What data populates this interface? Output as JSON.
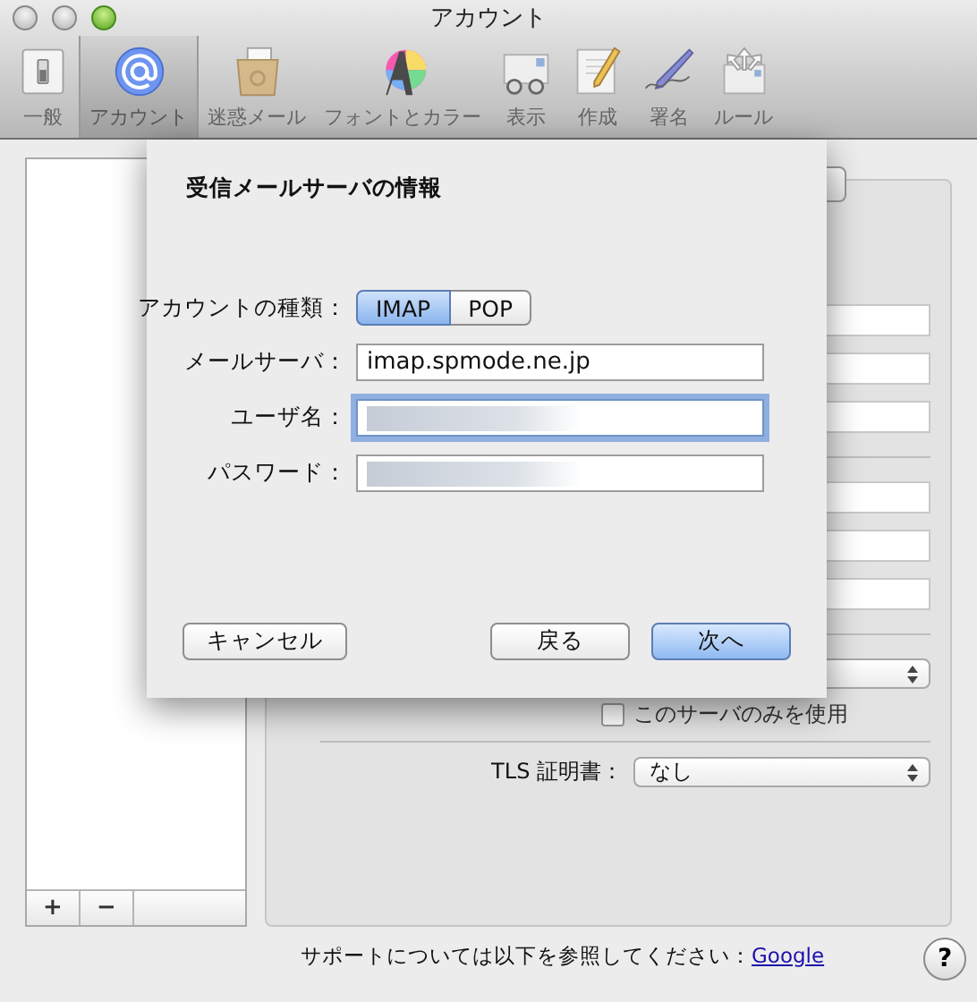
{
  "window": {
    "title": "アカウント"
  },
  "toolbar": [
    {
      "label": "一般",
      "selected": false
    },
    {
      "label": "アカウント",
      "selected": true
    },
    {
      "label": "迷惑メール",
      "selected": false
    },
    {
      "label": "フォントとカラー",
      "selected": false
    },
    {
      "label": "表示",
      "selected": false
    },
    {
      "label": "作成",
      "selected": false
    },
    {
      "label": "署名",
      "selected": false
    },
    {
      "label": "ルール",
      "selected": false
    }
  ],
  "sidebar": {
    "add_button": "+",
    "remove_button": "−"
  },
  "settings_panel": {
    "only_server": {
      "label": "このサーバのみを使用",
      "checked": false
    },
    "tls": {
      "label": "TLS 証明書：",
      "value": "なし"
    }
  },
  "footer": {
    "text": "サポートについては以下を参照してください：",
    "link": "Google"
  },
  "help_button": "?",
  "sheet": {
    "title": "受信メールサーバの情報",
    "account_type": {
      "label": "アカウントの種類：",
      "options": [
        {
          "label": "IMAP",
          "selected": true
        },
        {
          "label": "POP",
          "selected": false
        }
      ]
    },
    "fields": [
      {
        "label": "メールサーバ：",
        "value": "imap.spmode.ne.jp",
        "focused": false,
        "blurred": false
      },
      {
        "label": "ユーザ名：",
        "focused": true,
        "blurred": true
      },
      {
        "label": "パスワード：",
        "focused": false,
        "blurred": true
      }
    ],
    "buttons": [
      {
        "label": "キャンセル",
        "kind": "normal"
      },
      {
        "label": "戻る",
        "kind": "normal"
      },
      {
        "label": "次へ",
        "kind": "default"
      }
    ]
  }
}
